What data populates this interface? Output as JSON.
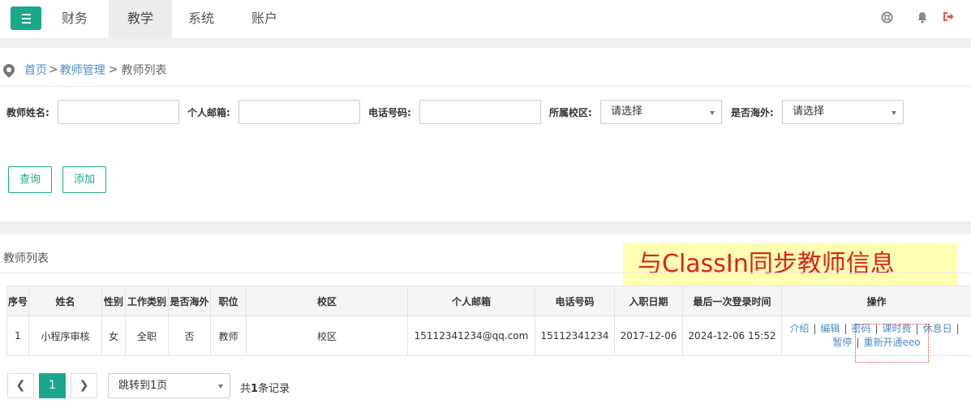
{
  "nav": {
    "items": [
      "财务",
      "教学",
      "系统",
      "账户"
    ],
    "active": "教学"
  },
  "breadcrumb": {
    "home": "首页",
    "parent": "教师管理",
    "current": "教师列表",
    "separator": ">"
  },
  "filters": {
    "name_label": "教师姓名:",
    "email_label": "个人邮箱:",
    "phone_label": "电话号码:",
    "campus_label": "所属校区:",
    "campus_value": "请选择",
    "overseas_label": "是否海外:",
    "overseas_value": "请选择"
  },
  "actions": {
    "search": "查询",
    "add": "添加"
  },
  "list": {
    "title": "教师列表",
    "annotation": "与ClassIn同步教师信息",
    "columns": [
      "序号",
      "姓名",
      "性别",
      "工作类别",
      "是否海外",
      "职位",
      "校区",
      "个人邮箱",
      "电话号码",
      "入职日期",
      "最后一次登录时间",
      "操作"
    ],
    "rows": [
      [
        "1",
        "小程序审核",
        "女",
        "全职",
        "否",
        "教师",
        "校区",
        "15112341234@qq.com",
        "15112341234",
        "2017-12-06",
        "2024-12-06 15:52"
      ]
    ],
    "operations": [
      "介绍",
      "编辑",
      "密码",
      "课时费",
      "休息日",
      "暂停",
      "重新开通eeo"
    ]
  },
  "pagination": {
    "current": "1",
    "jump_value": "跳转到1页",
    "total_prefix": "共",
    "total_count": "1",
    "total_suffix": "条记录"
  },
  "colors": {
    "accent": "#1aa88c",
    "link": "#4b8cc8",
    "annotation_text": "#e02020",
    "annotation_bg": "#ffffb3"
  }
}
